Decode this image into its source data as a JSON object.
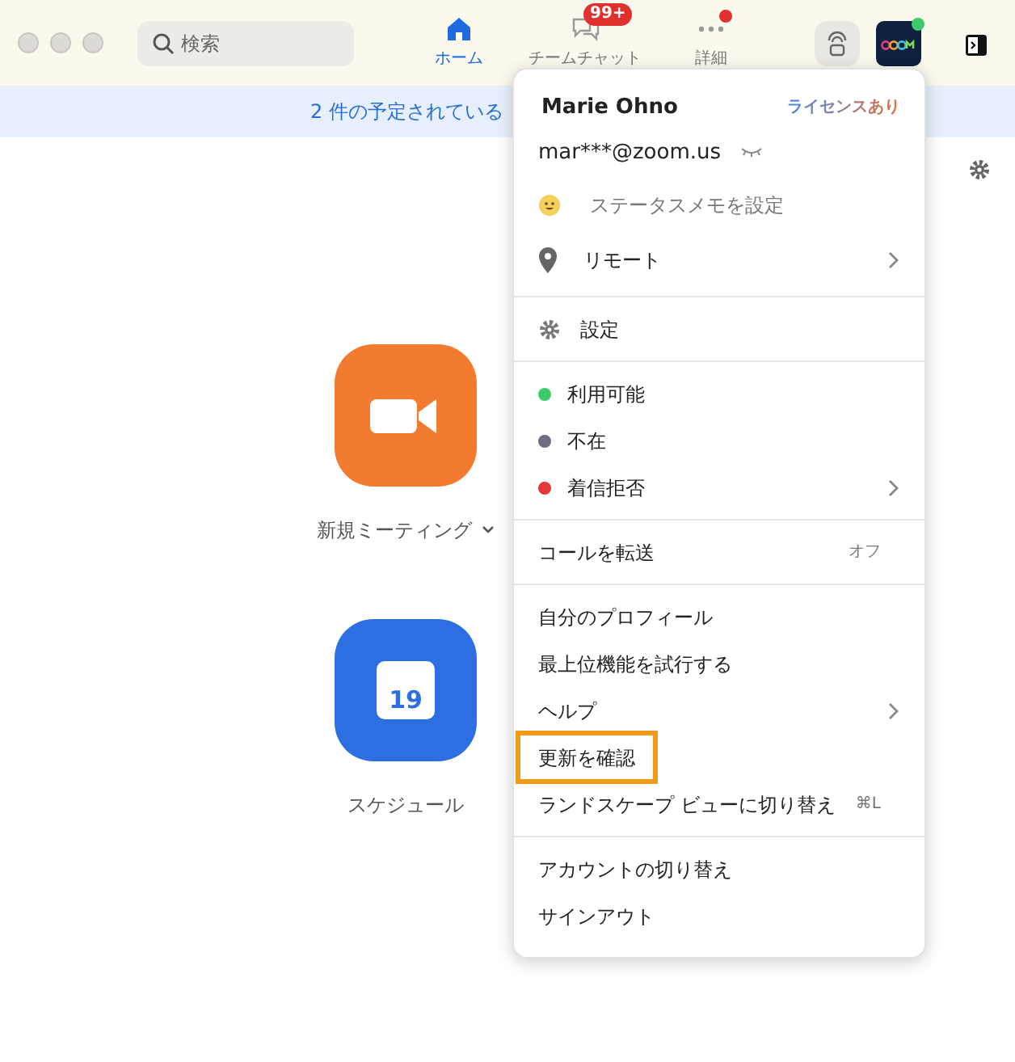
{
  "toolbar": {
    "search": {
      "placeholder": "検索"
    },
    "tabs": [
      {
        "label": "ホーム",
        "kind": "home",
        "selected": true,
        "dot": false
      },
      {
        "label": "チームチャット",
        "kind": "chat",
        "selected": false,
        "badge": "99+",
        "dot": false
      },
      {
        "label": "詳細",
        "kind": "more",
        "selected": false,
        "dot": true
      }
    ],
    "avatar": {
      "online": true
    }
  },
  "banner": {
    "text": "2 件の予定されている"
  },
  "actions": [
    {
      "label": "新規ミーティング",
      "kind": "video",
      "color": "#f37b2f",
      "dropdown": true
    },
    {
      "label": "スケジュール",
      "kind": "calendar",
      "color": "#2d6fe3",
      "dropdown": false,
      "day": "19"
    }
  ],
  "menu": {
    "name": "Marie Ohno",
    "license": "ライセンスあり",
    "email": "mar***@zoom.us",
    "sections": [
      [
        {
          "label": "ステータスメモを設定",
          "kind": "emoji",
          "muted": true,
          "submenu": false,
          "highlighted": false
        },
        {
          "label": "リモート",
          "kind": "pin",
          "muted": false,
          "submenu": true,
          "highlighted": false
        }
      ],
      [
        {
          "label": "設定",
          "kind": "gear",
          "muted": false,
          "submenu": false,
          "highlighted": false
        }
      ],
      [
        {
          "label": "利用可能",
          "kind": "dot",
          "color": "#3fc96a",
          "muted": false,
          "submenu": false,
          "highlighted": false
        },
        {
          "label": "不在",
          "kind": "dot",
          "color": "#6e6e80",
          "muted": false,
          "submenu": false,
          "highlighted": false
        },
        {
          "label": "着信拒否",
          "kind": "dot",
          "color": "#e5383b",
          "muted": false,
          "submenu": true,
          "highlighted": false
        }
      ],
      [
        {
          "label": "コールを転送",
          "trailing": "オフ",
          "muted": false,
          "submenu": false,
          "highlighted": false
        }
      ],
      [
        {
          "label": "自分のプロフィール",
          "muted": false,
          "submenu": false,
          "highlighted": false
        },
        {
          "label": "最上位機能を試行する",
          "muted": false,
          "submenu": false,
          "highlighted": false
        },
        {
          "label": "ヘルプ",
          "muted": false,
          "submenu": true,
          "highlighted": false
        },
        {
          "label": "更新を確認",
          "muted": false,
          "submenu": false,
          "highlighted": true
        },
        {
          "label": "ランドスケープ ビューに切り替え",
          "trailing": "⌘L",
          "muted": false,
          "submenu": false,
          "highlighted": false
        }
      ],
      [
        {
          "label": "アカウントの切り替え",
          "muted": false,
          "submenu": false,
          "highlighted": false
        },
        {
          "label": "サインアウト",
          "muted": false,
          "submenu": false,
          "highlighted": false
        }
      ]
    ]
  }
}
